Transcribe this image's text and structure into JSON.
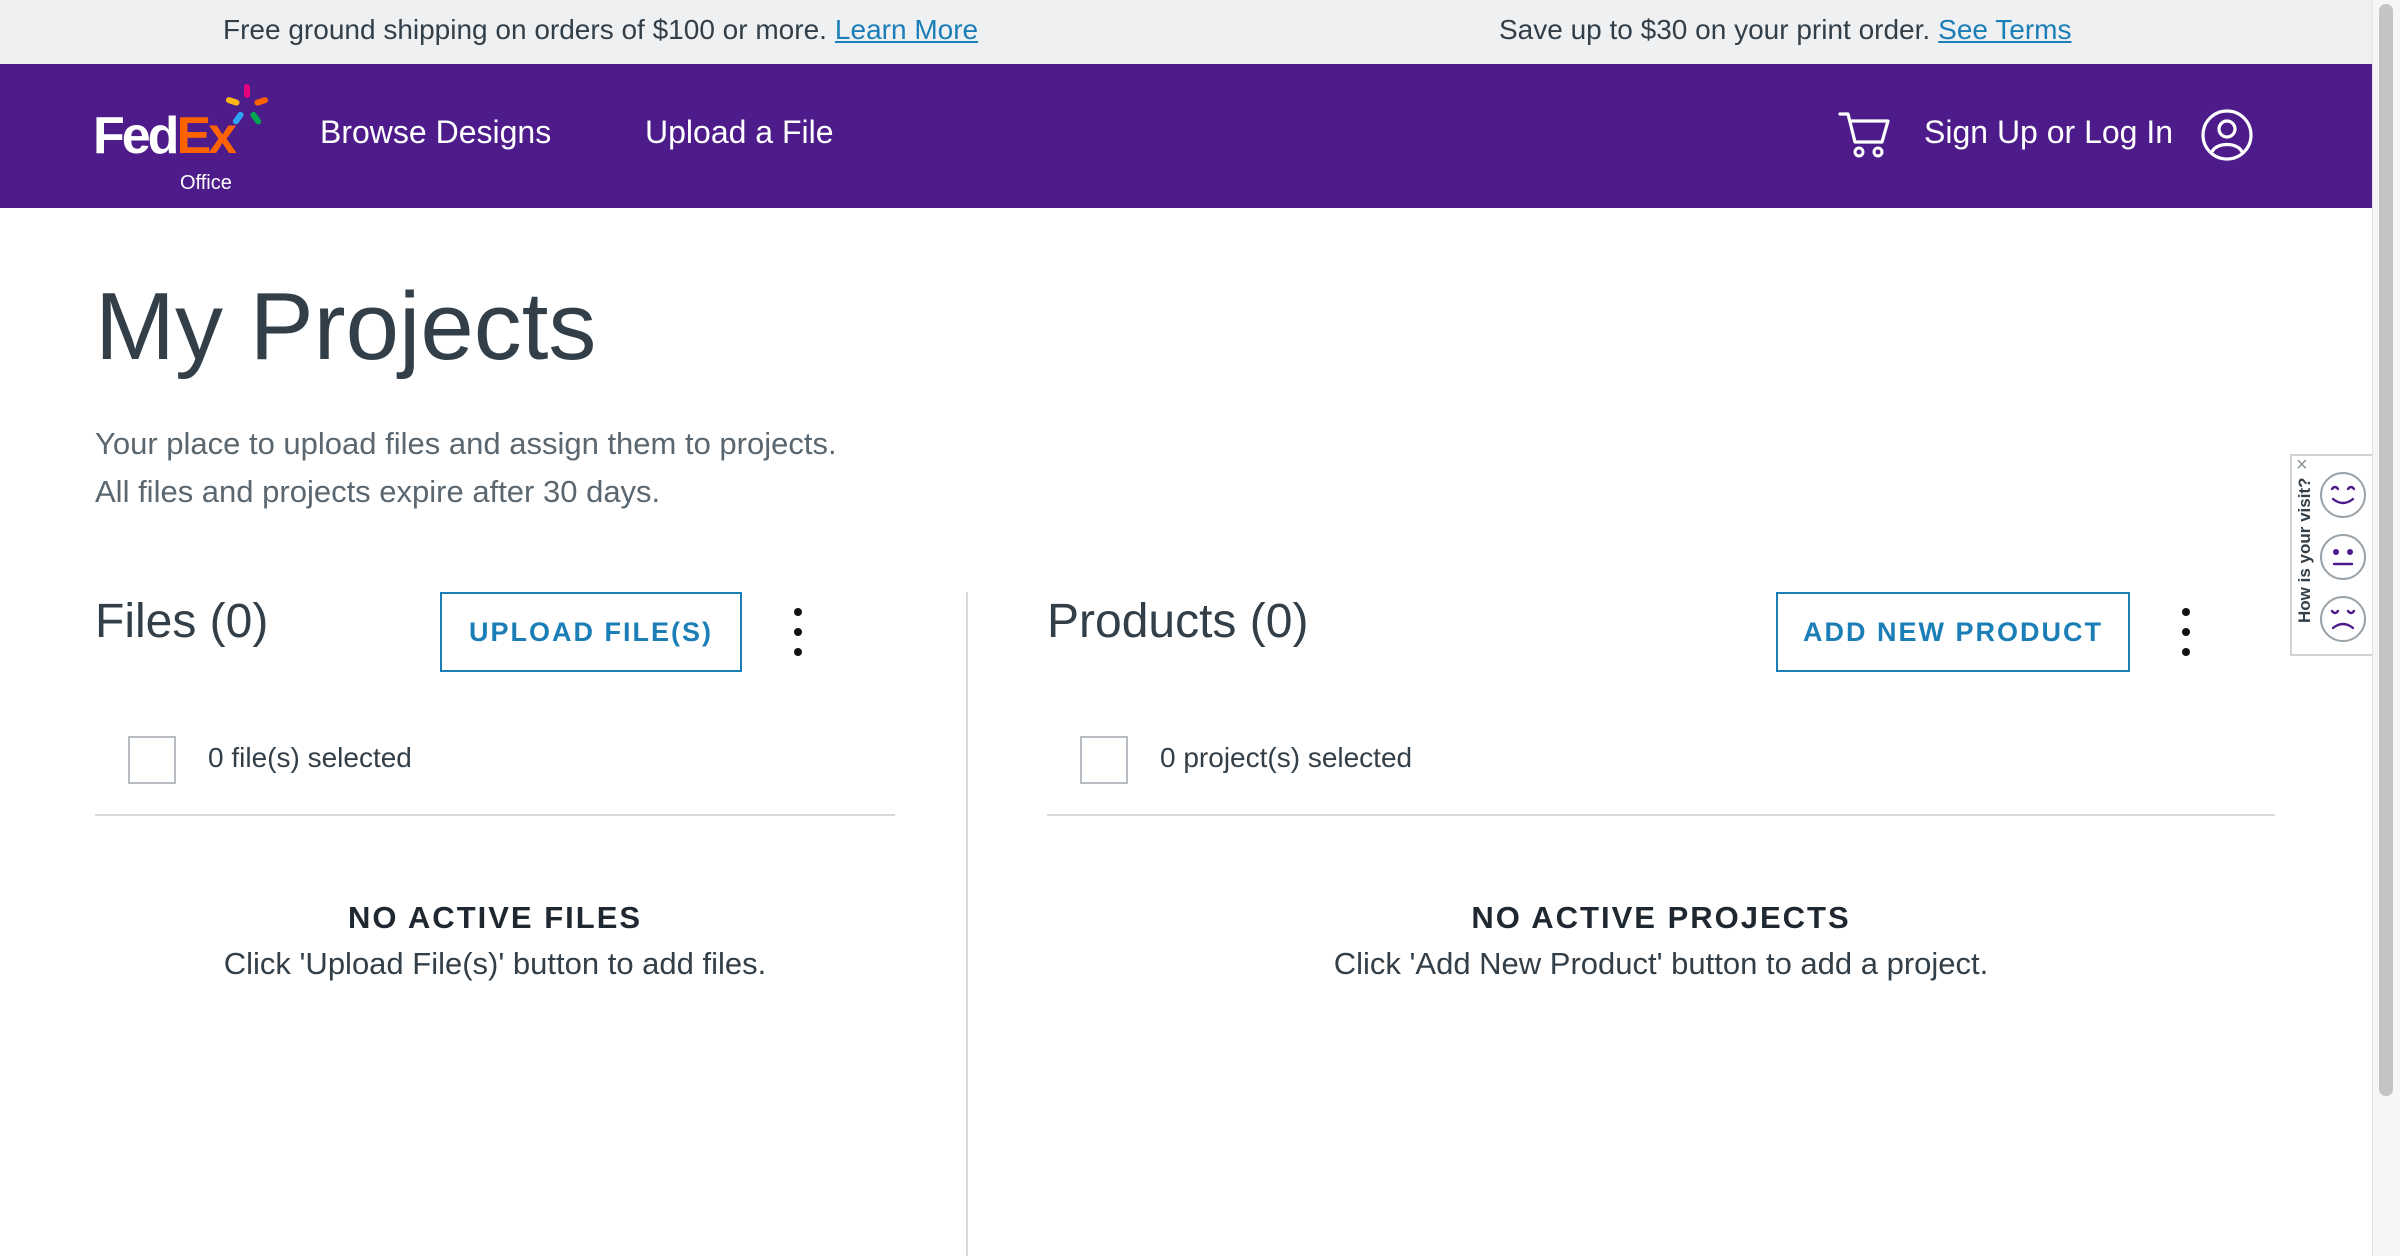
{
  "promo": {
    "left_text": "Free ground shipping on orders of $100 or more.",
    "left_link": "Learn More",
    "right_text": "Save up to $30 on your print order.",
    "right_link": "See Terms"
  },
  "header": {
    "logo_fed": "Fed",
    "logo_ex": "Ex",
    "logo_office": "Office",
    "nav": [
      "Browse Designs",
      "Upload a File"
    ],
    "sign_in": "Sign Up or Log In",
    "icons": [
      "cart-icon",
      "account-icon"
    ]
  },
  "page": {
    "title": "My Projects",
    "intro_line1": "Your place to upload files and assign them to projects.",
    "intro_line2": "All files and projects expire after 30 days."
  },
  "files": {
    "title": "Files (0)",
    "button": "UPLOAD FILE(S)",
    "selected": "0 file(s) selected",
    "empty_title": "NO ACTIVE FILES",
    "empty_text": "Click 'Upload File(s)' button to add files."
  },
  "products": {
    "title": "Products (0)",
    "button": "ADD NEW PRODUCT",
    "selected": "0 project(s) selected",
    "empty_title": "NO ACTIVE PROJECTS",
    "empty_text": "Click 'Add New Product' button to add a project."
  },
  "feedback": {
    "label": "How is your visit?",
    "close": "×",
    "faces": [
      "happy-face-icon",
      "neutral-face-icon",
      "sad-face-icon"
    ]
  },
  "colors": {
    "header_bg": "#4d1c8a",
    "promo_bg": "#eef0f2",
    "accent": "#1b7eb6",
    "fedex_orange": "#ff6200"
  }
}
